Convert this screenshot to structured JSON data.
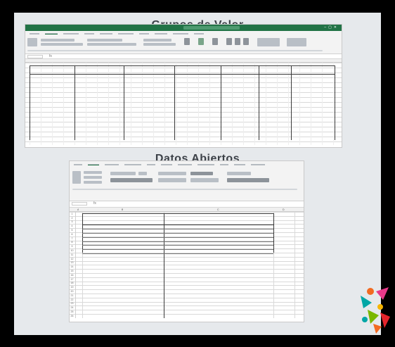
{
  "headings": {
    "grupos": "Grupos de Valor",
    "datos": "Datos Abiertos"
  },
  "excel1": {
    "ribbon_tabs": [
      "",
      "",
      "",
      "",
      "",
      "",
      "",
      "",
      "",
      ""
    ],
    "columns": [
      "",
      "",
      "",
      "",
      "",
      "",
      ""
    ]
  },
  "excel2": {
    "ribbon_tabs": [
      "",
      "",
      "",
      "",
      "",
      "",
      "",
      "",
      "",
      "",
      ""
    ],
    "col_headers": [
      "A",
      "B",
      "C",
      "D"
    ],
    "table_headers": [
      "",
      ""
    ],
    "rows": [
      "",
      "",
      "",
      "",
      "",
      "",
      ""
    ],
    "row_numbers": [
      "1",
      "2",
      "3",
      "4",
      "5",
      "6",
      "7",
      "8",
      "9",
      "10",
      "11",
      "12",
      "13",
      "14",
      "15",
      "16",
      "17",
      "18",
      "19",
      "20",
      "21",
      "22",
      "23",
      "24",
      "25",
      "26"
    ]
  },
  "colors": {
    "excel_green": "#217346",
    "panel_bg": "#e6e9ec",
    "heading": "#3c4148"
  }
}
